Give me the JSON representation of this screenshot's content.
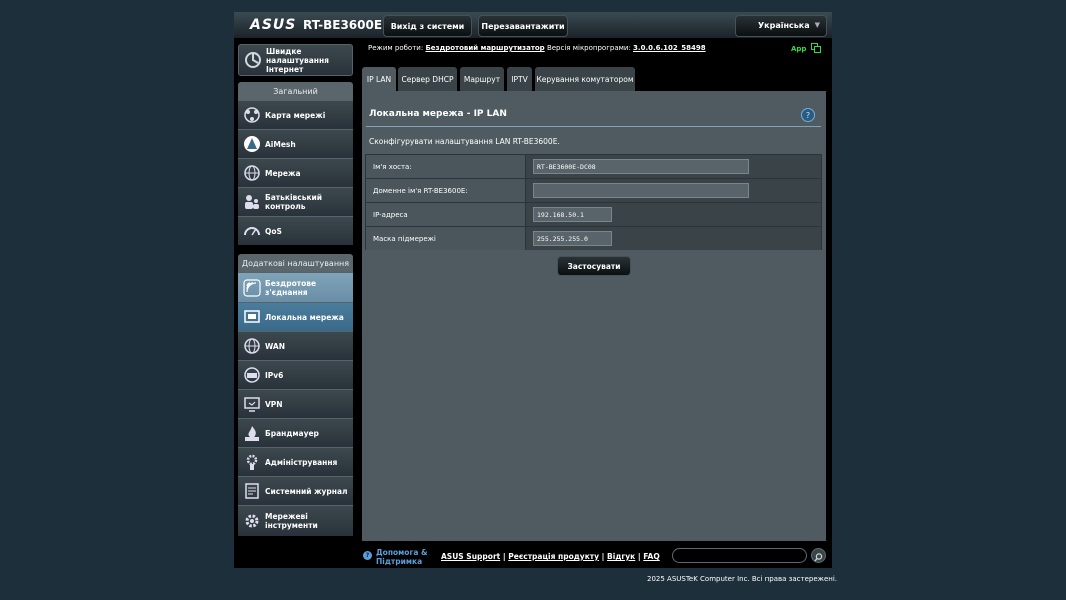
{
  "header": {
    "logo": "ASUS",
    "model": "RT-BE3600E",
    "logout_label": "Вихід з системи",
    "reboot_label": "Перезавантажити",
    "language": "Українська"
  },
  "status": {
    "mode_label": "Режим роботи:",
    "mode_value": "Бездротовий маршрутизатор",
    "firmware_label": "Версія мікропрограми:",
    "firmware_value": "3.0.0.6.102_58498",
    "app_label": "App"
  },
  "sidebar": {
    "quick_setup": "Швидке налаштування Інтернет",
    "general_header": "Загальний",
    "general_items": [
      {
        "label": "Карта мережі",
        "icon": "network-map-icon"
      },
      {
        "label": "AiMesh",
        "icon": "aimesh-icon"
      },
      {
        "label": "Мережа",
        "icon": "network-globe-icon"
      },
      {
        "label": "Батьківський контроль",
        "icon": "parental-control-icon"
      },
      {
        "label": "QoS",
        "icon": "qos-gauge-icon"
      }
    ],
    "advanced_header": "Додаткові налаштування",
    "advanced_items": [
      {
        "label": "Бездротове з'єднання",
        "icon": "wireless-icon"
      },
      {
        "label": "Локальна мережа",
        "icon": "lan-icon"
      },
      {
        "label": "WAN",
        "icon": "wan-globe-icon"
      },
      {
        "label": "IPv6",
        "icon": "ipv6-icon"
      },
      {
        "label": "VPN",
        "icon": "vpn-icon"
      },
      {
        "label": "Брандмауер",
        "icon": "firewall-icon"
      },
      {
        "label": "Адміністрування",
        "icon": "admin-gear-icon"
      },
      {
        "label": "Системний журнал",
        "icon": "system-log-icon"
      },
      {
        "label": "Мережеві інструменти",
        "icon": "network-tools-icon"
      }
    ]
  },
  "tabs": [
    "IP LAN",
    "Сервер DHCP",
    "Маршрут",
    "IPTV",
    "Керування комутатором"
  ],
  "main": {
    "title": "Локальна мережа - IP LAN",
    "help": "?",
    "description": "Сконфігурувати налаштування LAN RT-BE3600E.",
    "fields": [
      {
        "label": "Ім'я хоста:",
        "value": "RT-BE3600E-DC08"
      },
      {
        "label": "Доменне ім'я RT-BE3600E:",
        "value": ""
      },
      {
        "label": "IP-адреса",
        "value": "192.168.50.1"
      },
      {
        "label": "Маска підмережі",
        "value": "255.255.255.0"
      }
    ],
    "apply_label": "Застосувати"
  },
  "footer": {
    "help_line1": "Допомога &",
    "help_line2": "Підтримка",
    "link_support": "ASUS Support",
    "link_register": "Реєстрація продукту",
    "link_feedback": "Відгук",
    "link_faq": "FAQ",
    "sep": "|",
    "copyright": "2025 ASUSTeK Computer Inc. Всі права застережені."
  }
}
